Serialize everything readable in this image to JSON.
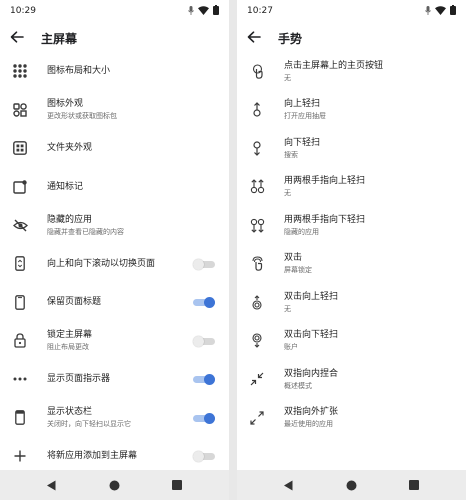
{
  "left": {
    "status": {
      "time": "10:29"
    },
    "title": "主屏幕",
    "items": [
      {
        "label": "图标布局和大小",
        "sub": ""
      },
      {
        "label": "图标外观",
        "sub": "更改形状或获取图标包"
      },
      {
        "label": "文件夹外观",
        "sub": ""
      },
      {
        "label": "通知标记",
        "sub": ""
      },
      {
        "label": "隐藏的应用",
        "sub": "隐藏并查看已隐藏的内容"
      },
      {
        "label": "向上和向下滚动以切换页面",
        "sub": ""
      },
      {
        "label": "保留页面标题",
        "sub": ""
      },
      {
        "label": "锁定主屏幕",
        "sub": "阻止布局更改"
      },
      {
        "label": "显示页面指示器",
        "sub": ""
      },
      {
        "label": "显示状态栏",
        "sub": "关闭时，向下轻扫以显示它"
      },
      {
        "label": "将新应用添加到主屏幕",
        "sub": ""
      }
    ],
    "toggles": {
      "scroll_switch_pages": false,
      "keep_page_title": true,
      "lock_home": false,
      "page_indicator": true,
      "status_bar": true,
      "add_new_apps": false
    }
  },
  "right": {
    "status": {
      "time": "10:27"
    },
    "title": "手势",
    "items": [
      {
        "label": "点击主屏幕上的主页按钮",
        "sub": "无"
      },
      {
        "label": "向上轻扫",
        "sub": "打开应用抽屉"
      },
      {
        "label": "向下轻扫",
        "sub": "搜索"
      },
      {
        "label": "用两根手指向上轻扫",
        "sub": "无"
      },
      {
        "label": "用两根手指向下轻扫",
        "sub": "隐藏的应用"
      },
      {
        "label": "双击",
        "sub": "屏幕锁定"
      },
      {
        "label": "双击向上轻扫",
        "sub": "无"
      },
      {
        "label": "双击向下轻扫",
        "sub": "账户"
      },
      {
        "label": "双指向内捏合",
        "sub": "概述模式"
      },
      {
        "label": "双指向外扩张",
        "sub": "最近使用的应用"
      }
    ]
  },
  "colors": {
    "accent": "#3d74d6",
    "accent_track": "#a9c4ef",
    "nav_bg": "#ececec"
  }
}
